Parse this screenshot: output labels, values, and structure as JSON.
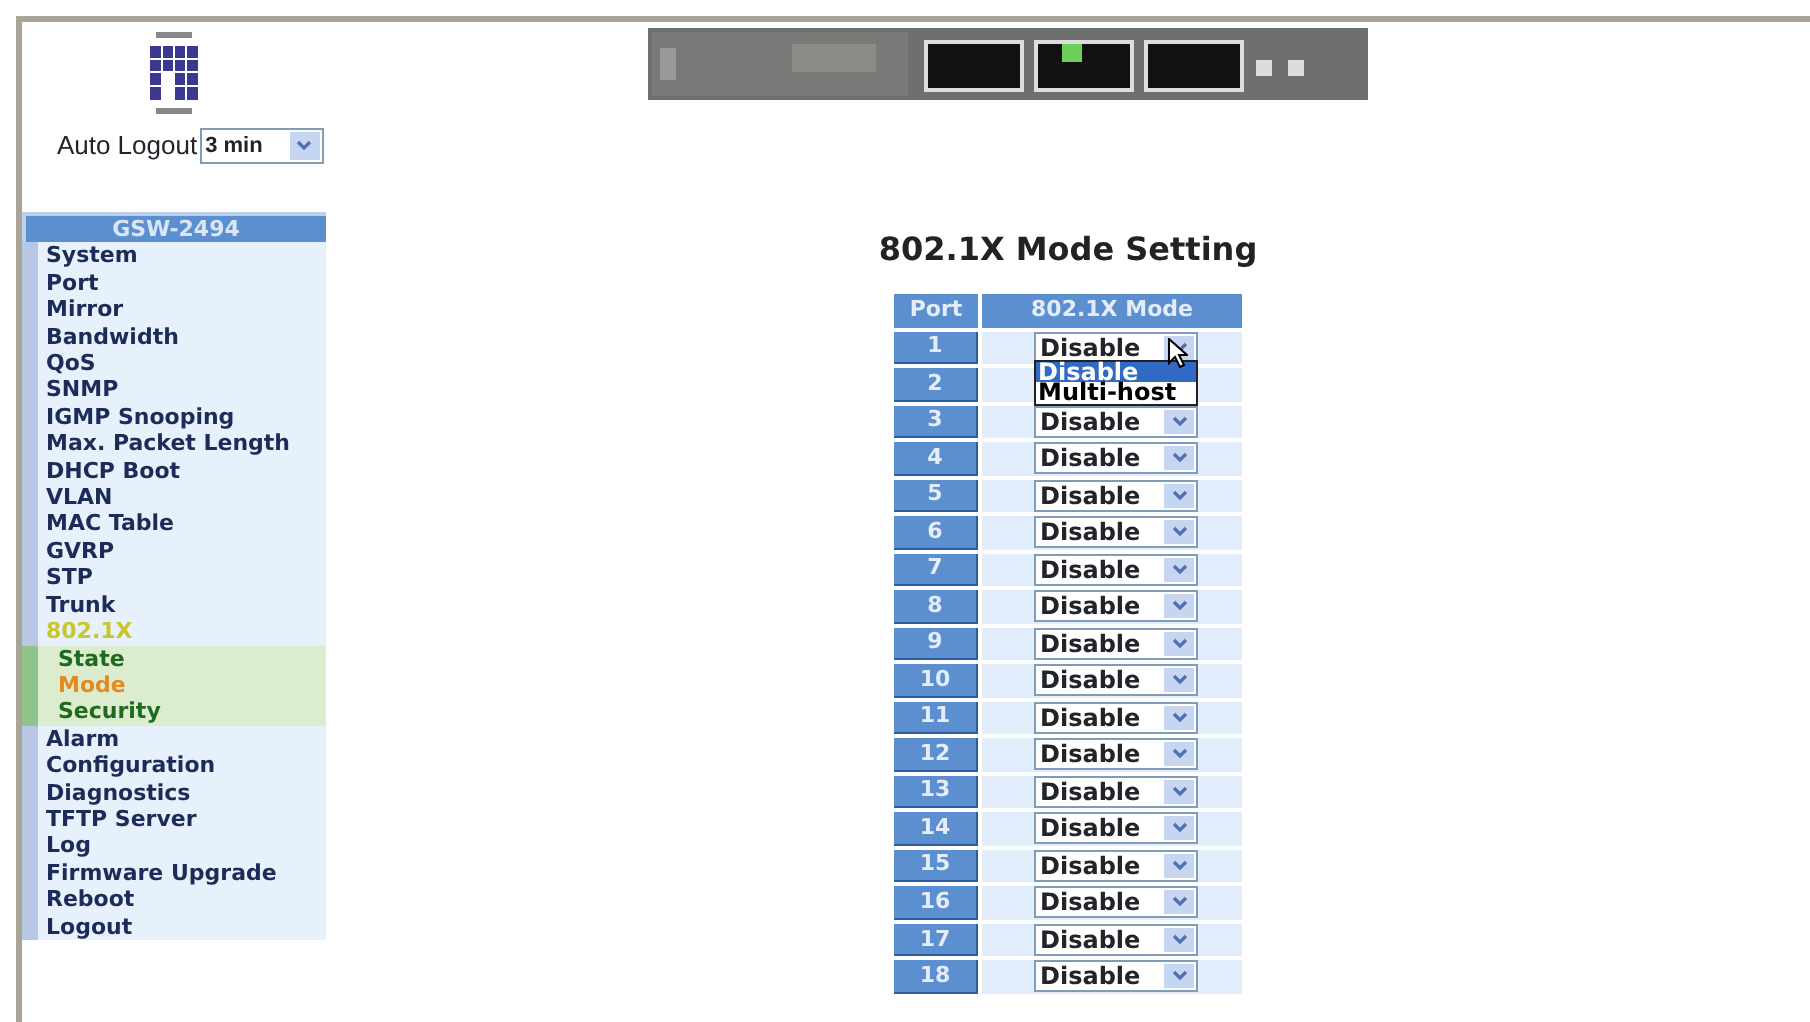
{
  "auto_logout": {
    "label": "Auto Logout",
    "value": "3 min"
  },
  "sidebar": {
    "title": "GSW-2494",
    "items": [
      {
        "label": "System",
        "selected": false
      },
      {
        "label": "Port",
        "selected": false
      },
      {
        "label": "Mirror",
        "selected": false
      },
      {
        "label": "Bandwidth",
        "selected": false
      },
      {
        "label": "QoS",
        "selected": false
      },
      {
        "label": "SNMP",
        "selected": false
      },
      {
        "label": "IGMP Snooping",
        "selected": false
      },
      {
        "label": "Max. Packet Length",
        "selected": false
      },
      {
        "label": "DHCP Boot",
        "selected": false
      },
      {
        "label": "VLAN",
        "selected": false
      },
      {
        "label": "MAC Table",
        "selected": false
      },
      {
        "label": "GVRP",
        "selected": false
      },
      {
        "label": "STP",
        "selected": false
      },
      {
        "label": "Trunk",
        "selected": false
      },
      {
        "label": "802.1X",
        "selected": false,
        "expanded": true,
        "children": [
          {
            "label": "State",
            "selected": false
          },
          {
            "label": "Mode",
            "selected": true
          },
          {
            "label": "Security",
            "selected": false
          }
        ]
      },
      {
        "label": "Alarm",
        "selected": false
      },
      {
        "label": "Configuration",
        "selected": false
      },
      {
        "label": "Diagnostics",
        "selected": false
      },
      {
        "label": "TFTP Server",
        "selected": false
      },
      {
        "label": "Log",
        "selected": false
      },
      {
        "label": "Firmware Upgrade",
        "selected": false
      },
      {
        "label": "Reboot",
        "selected": false
      },
      {
        "label": "Logout",
        "selected": false
      }
    ]
  },
  "title": "802.1X Mode Setting",
  "table": {
    "columns": [
      "Port",
      "802.1X Mode"
    ],
    "rows": [
      {
        "port": "1",
        "mode": "Disable",
        "open_menu": {
          "options": [
            {
              "label": "Disable",
              "selected": true
            },
            {
              "label": "Multi-host",
              "selected": false
            }
          ]
        }
      },
      {
        "port": "2"
      },
      {
        "port": "3",
        "mode": "Disable"
      },
      {
        "port": "4",
        "mode": "Disable"
      },
      {
        "port": "5",
        "mode": "Disable"
      },
      {
        "port": "6",
        "mode": "Disable"
      },
      {
        "port": "7",
        "mode": "Disable"
      },
      {
        "port": "8",
        "mode": "Disable"
      },
      {
        "port": "9",
        "mode": "Disable"
      },
      {
        "port": "10",
        "mode": "Disable"
      },
      {
        "port": "11",
        "mode": "Disable"
      },
      {
        "port": "12",
        "mode": "Disable"
      },
      {
        "port": "13",
        "mode": "Disable"
      },
      {
        "port": "14",
        "mode": "Disable"
      },
      {
        "port": "15",
        "mode": "Disable"
      },
      {
        "port": "16",
        "mode": "Disable"
      },
      {
        "port": "17",
        "mode": "Disable"
      },
      {
        "port": "18",
        "mode": "Disable"
      }
    ]
  }
}
